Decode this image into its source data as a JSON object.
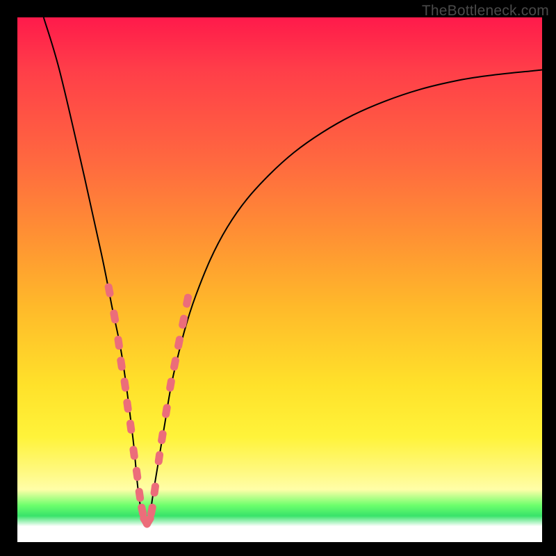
{
  "watermark": "TheBottleneck.com",
  "colors": {
    "frame": "#000000",
    "marker": "#ec6d7a",
    "curve": "#000000"
  },
  "chart_data": {
    "type": "line",
    "title": "",
    "xlabel": "",
    "ylabel": "",
    "xlim": [
      0,
      100
    ],
    "ylim": [
      0,
      100
    ],
    "note": "Axes are unlabeled; x is normalized horizontal position, y is normalized bottleneck percentage (0 at bottom, 100 at top). Vertex near x≈24 where bottleneck≈0.",
    "series": [
      {
        "name": "bottleneck-curve",
        "x": [
          5,
          8,
          12,
          16,
          18,
          20,
          22,
          23,
          24,
          25,
          26,
          28,
          30,
          34,
          40,
          48,
          58,
          70,
          84,
          100
        ],
        "y": [
          100,
          90,
          73,
          55,
          45,
          35,
          20,
          10,
          4,
          4,
          10,
          22,
          33,
          47,
          60,
          70,
          78,
          84,
          88,
          90
        ]
      }
    ],
    "markers": {
      "name": "highlighted-range",
      "description": "Pink capsule markers along curve near the vertex region",
      "points": [
        {
          "x": 17.5,
          "y": 48
        },
        {
          "x": 18.5,
          "y": 43
        },
        {
          "x": 19.3,
          "y": 38
        },
        {
          "x": 19.8,
          "y": 34
        },
        {
          "x": 20.5,
          "y": 30
        },
        {
          "x": 21.0,
          "y": 26
        },
        {
          "x": 21.6,
          "y": 22
        },
        {
          "x": 22.2,
          "y": 17
        },
        {
          "x": 22.8,
          "y": 13
        },
        {
          "x": 23.3,
          "y": 9
        },
        {
          "x": 23.8,
          "y": 6
        },
        {
          "x": 24.4,
          "y": 4
        },
        {
          "x": 25.0,
          "y": 4
        },
        {
          "x": 25.6,
          "y": 6
        },
        {
          "x": 26.2,
          "y": 10
        },
        {
          "x": 27.0,
          "y": 16
        },
        {
          "x": 27.6,
          "y": 20
        },
        {
          "x": 28.4,
          "y": 25
        },
        {
          "x": 29.2,
          "y": 30
        },
        {
          "x": 30.0,
          "y": 34
        },
        {
          "x": 30.8,
          "y": 38
        },
        {
          "x": 31.6,
          "y": 42
        },
        {
          "x": 32.4,
          "y": 46
        }
      ]
    }
  }
}
